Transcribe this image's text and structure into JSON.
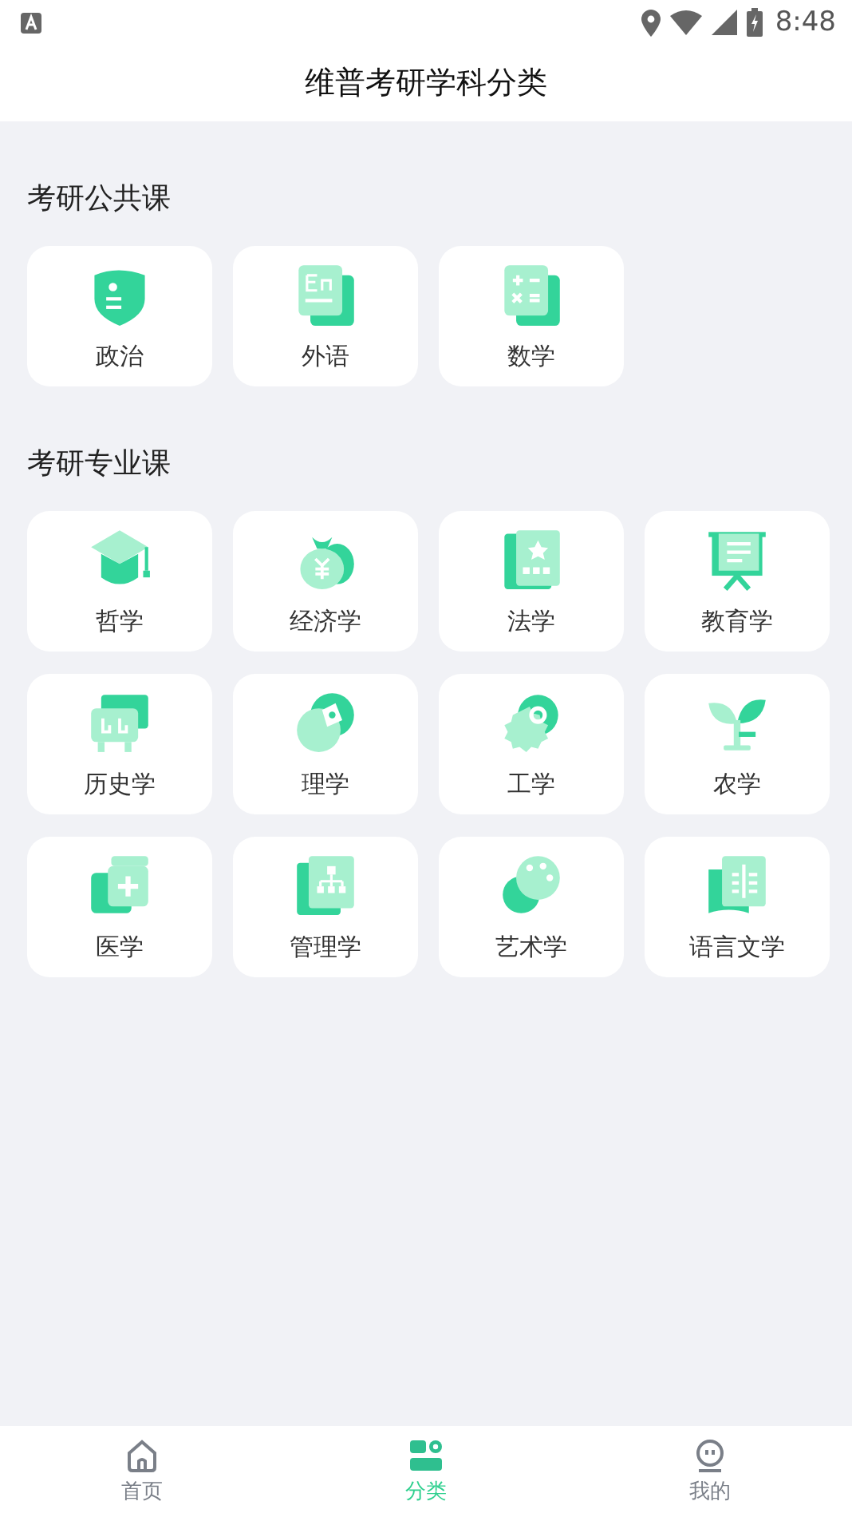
{
  "status_bar": {
    "time": "8:48"
  },
  "header": {
    "title": "维普考研学科分类"
  },
  "sections": [
    {
      "title": "考研公共课",
      "items": [
        {
          "label": "政治"
        },
        {
          "label": "外语"
        },
        {
          "label": "数学"
        }
      ]
    },
    {
      "title": "考研专业课",
      "items": [
        {
          "label": "哲学"
        },
        {
          "label": "经济学"
        },
        {
          "label": "法学"
        },
        {
          "label": "教育学"
        },
        {
          "label": "历史学"
        },
        {
          "label": "理学"
        },
        {
          "label": "工学"
        },
        {
          "label": "农学"
        },
        {
          "label": "医学"
        },
        {
          "label": "管理学"
        },
        {
          "label": "艺术学"
        },
        {
          "label": "语言文学"
        }
      ]
    }
  ],
  "bottom_nav": [
    {
      "label": "首页",
      "selected": false
    },
    {
      "label": "分类",
      "selected": true
    },
    {
      "label": "我的",
      "selected": false
    }
  ]
}
